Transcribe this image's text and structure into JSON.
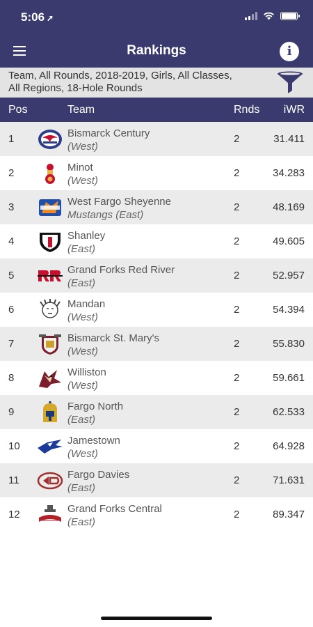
{
  "status": {
    "time": "5:06",
    "location_icon": "location-arrow-icon"
  },
  "header": {
    "title": "Rankings",
    "menu_icon": "hamburger-menu-icon",
    "info_icon": "info-icon"
  },
  "filter": {
    "line1": "Team, All Rounds, 2018-2019, Girls, All Classes,",
    "line2": "All Regions, 18-Hole Rounds",
    "icon": "funnel-filter-icon"
  },
  "columns": {
    "pos": "Pos",
    "team": "Team",
    "rnds": "Rnds",
    "iwr": "iWR"
  },
  "colors": {
    "primary": "#3a3a6e",
    "row_alt": "#ebebeb",
    "filter_bg": "#e3e3e3"
  },
  "rows": [
    {
      "pos": "1",
      "name": "Bismarck Century",
      "sub": "(West)",
      "rnds": "2",
      "iwr": "31.411",
      "logo": "century-patriots-logo-icon"
    },
    {
      "pos": "2",
      "name": "Minot",
      "sub": "(West)",
      "rnds": "2",
      "iwr": "34.283",
      "logo": "minot-magicians-logo-icon"
    },
    {
      "pos": "3",
      "name": "West Fargo Sheyenne",
      "sub": "Mustangs (East)",
      "rnds": "2",
      "iwr": "48.169",
      "logo": "sheyenne-mustangs-logo-icon"
    },
    {
      "pos": "4",
      "name": "Shanley",
      "sub": "(East)",
      "rnds": "2",
      "iwr": "49.605",
      "logo": "shanley-shield-logo-icon"
    },
    {
      "pos": "5",
      "name": "Grand Forks Red River",
      "sub": "(East)",
      "rnds": "2",
      "iwr": "52.957",
      "logo": "red-river-rr-logo-icon"
    },
    {
      "pos": "6",
      "name": "Mandan",
      "sub": "(West)",
      "rnds": "2",
      "iwr": "54.394",
      "logo": "mandan-braves-logo-icon"
    },
    {
      "pos": "7",
      "name": "Bismarck St. Mary's",
      "sub": "(West)",
      "rnds": "2",
      "iwr": "55.830",
      "logo": "st-marys-saints-logo-icon"
    },
    {
      "pos": "8",
      "name": "Williston",
      "sub": "(West)",
      "rnds": "2",
      "iwr": "59.661",
      "logo": "williston-coyote-logo-icon"
    },
    {
      "pos": "9",
      "name": "Fargo North",
      "sub": "(East)",
      "rnds": "2",
      "iwr": "62.533",
      "logo": "fargo-north-spartan-logo-icon"
    },
    {
      "pos": "10",
      "name": "Jamestown",
      "sub": "(West)",
      "rnds": "2",
      "iwr": "64.928",
      "logo": "jamestown-bluejay-logo-icon"
    },
    {
      "pos": "11",
      "name": "Fargo Davies",
      "sub": "(East)",
      "rnds": "2",
      "iwr": "71.631",
      "logo": "fargo-davies-eagle-logo-icon"
    },
    {
      "pos": "12",
      "name": "Grand Forks Central",
      "sub": "(East)",
      "rnds": "2",
      "iwr": "89.347",
      "logo": "gf-central-knights-logo-icon"
    }
  ]
}
